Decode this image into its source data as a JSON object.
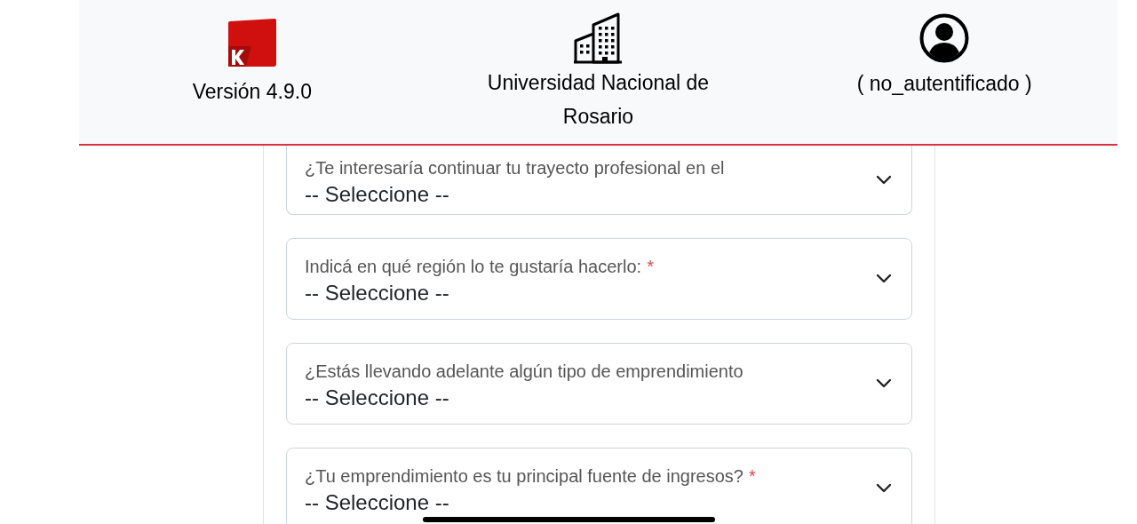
{
  "header": {
    "version": "Versión 4.9.0",
    "institution": "Universidad Nacional de Rosario",
    "user": "( no_autentificado )"
  },
  "fields": [
    {
      "label": "¿Te interesaría continuar tu trayecto profesional en el",
      "value": "-- Seleccione --"
    },
    {
      "label": "Indicá en qué región lo te gustaría hacerlo:",
      "required_mark": "*",
      "value": "-- Seleccione --"
    },
    {
      "label": "¿Estás llevando adelante algún tipo de emprendimiento",
      "value": "-- Seleccione --"
    },
    {
      "label": "¿Tu emprendimiento es tu principal fuente de ingresos?",
      "required_mark": "*",
      "value": "-- Seleccione --"
    }
  ]
}
